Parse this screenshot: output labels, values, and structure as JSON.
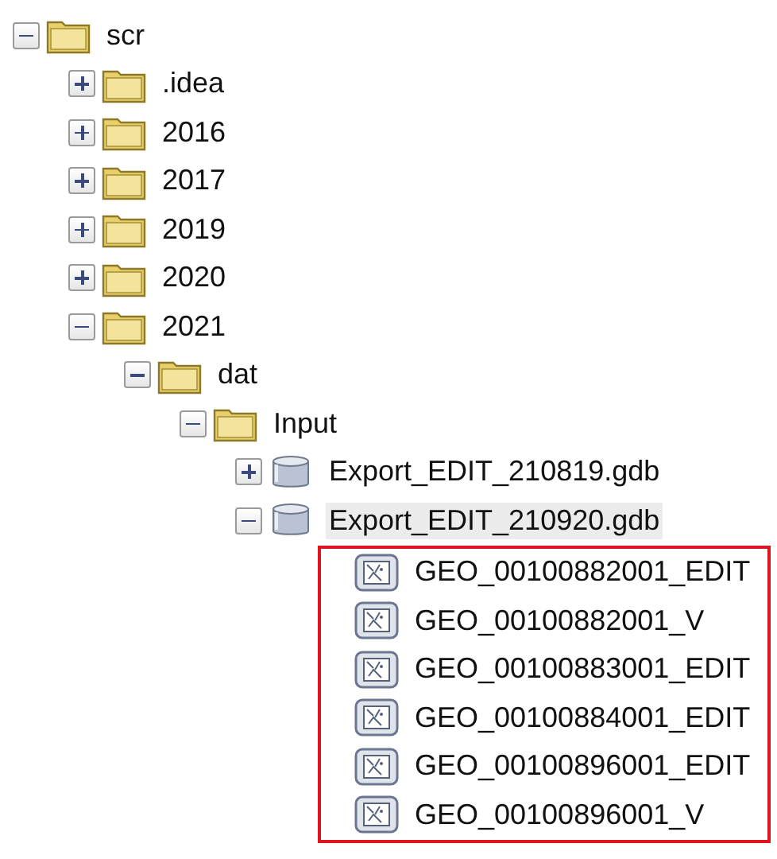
{
  "tree": [
    {
      "kind": "folder",
      "label": "scr",
      "expanded": true,
      "selected": false,
      "children": [
        {
          "kind": "folder",
          "label": ".idea",
          "expanded": false,
          "selected": false
        },
        {
          "kind": "folder",
          "label": "2016",
          "expanded": false,
          "selected": false
        },
        {
          "kind": "folder",
          "label": "2017",
          "expanded": false,
          "selected": false
        },
        {
          "kind": "folder",
          "label": "2019",
          "expanded": false,
          "selected": false
        },
        {
          "kind": "folder",
          "label": "2020",
          "expanded": false,
          "selected": false
        },
        {
          "kind": "folder",
          "label": "2021",
          "expanded": true,
          "selected": false,
          "children": [
            {
              "kind": "folder",
              "label": "dat",
              "expanded": true,
              "selected": false,
              "children": [
                {
                  "kind": "folder",
                  "label": "Input",
                  "expanded": true,
                  "selected": false,
                  "children": [
                    {
                      "kind": "geodatabase",
                      "label": "Export_EDIT_210819.gdb",
                      "expanded": false,
                      "selected": false
                    },
                    {
                      "kind": "geodatabase",
                      "label": "Export_EDIT_210920.gdb",
                      "expanded": true,
                      "selected": true,
                      "children_outlined": true,
                      "children": [
                        {
                          "kind": "dataset",
                          "label": "GEO_00100882001_EDIT",
                          "selected": false
                        },
                        {
                          "kind": "dataset",
                          "label": "GEO_00100882001_V",
                          "selected": false
                        },
                        {
                          "kind": "dataset",
                          "label": "GEO_00100883001_EDIT",
                          "selected": false
                        },
                        {
                          "kind": "dataset",
                          "label": "GEO_00100884001_EDIT",
                          "selected": false
                        },
                        {
                          "kind": "dataset",
                          "label": "GEO_00100896001_EDIT",
                          "selected": false
                        },
                        {
                          "kind": "dataset",
                          "label": "GEO_00100896001_V",
                          "selected": false
                        }
                      ]
                    }
                  ]
                }
              ]
            }
          ]
        }
      ]
    }
  ]
}
